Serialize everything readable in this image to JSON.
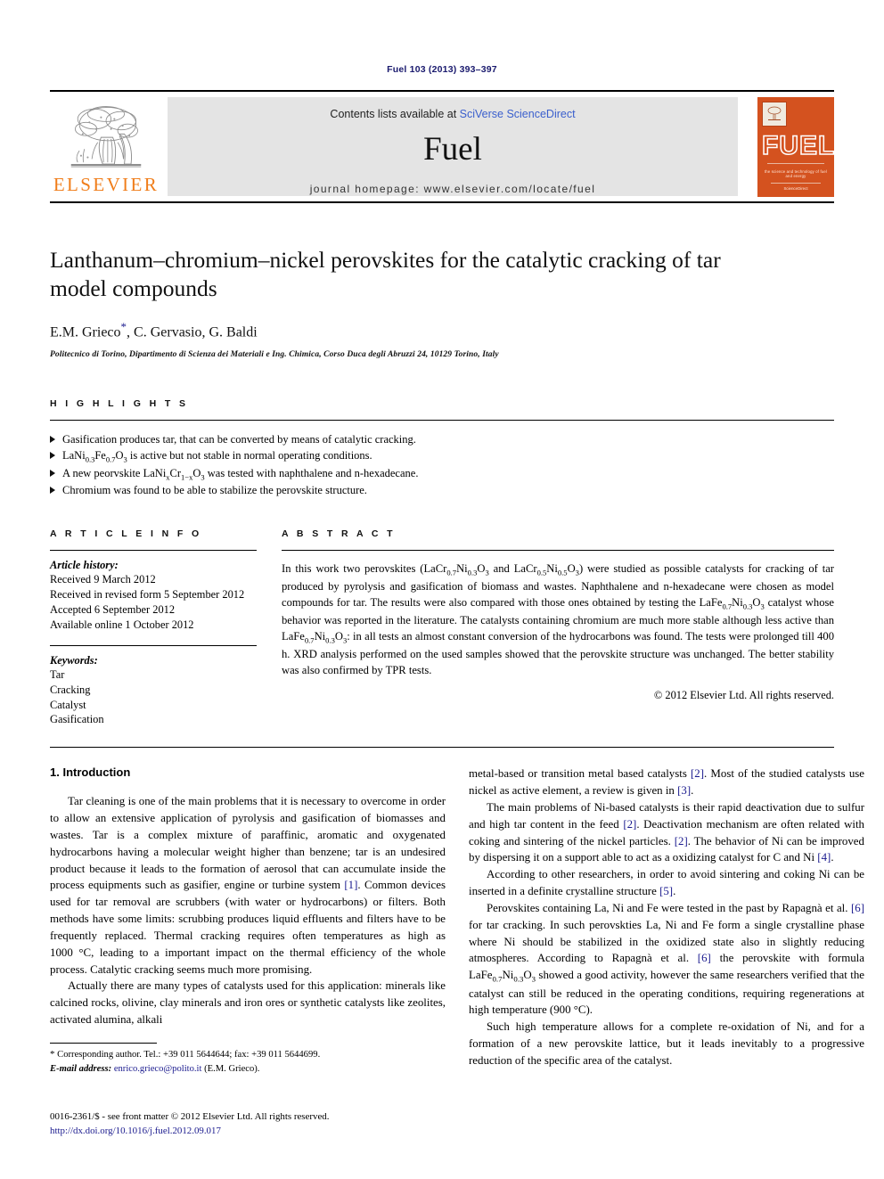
{
  "running_head": "Fuel 103 (2013) 393–397",
  "masthead": {
    "publisher_name": "ELSEVIER",
    "contents_prefix": "Contents lists available at ",
    "contents_link": "SciVerse ScienceDirect",
    "journal_title": "Fuel",
    "homepage": "journal homepage: www.elsevier.com/locate/fuel",
    "cover": {
      "title": "FUEL",
      "tagline": "the science and technology of fuel and energy",
      "footer": "ScienceDirect"
    }
  },
  "article": {
    "title": "Lanthanum–chromium–nickel perovskites for the catalytic cracking of tar model compounds",
    "authors": "E.M. Grieco",
    "authors_rest": ", C. Gervasio, G. Baldi",
    "corresponding_marker": "*",
    "affiliation": "Politecnico di Torino, Dipartimento di Scienza dei Materiali e Ing. Chimica, Corso Duca degli Abruzzi 24, 10129 Torino, Italy"
  },
  "highlights": {
    "heading": "H I G H L I G H T S",
    "items": [
      "Gasification produces tar, that can be converted by means of catalytic cracking.",
      "LaNi0.3Fe0.7O3 is active but not stable in normal operating conditions.",
      "A new peorvskite LaNixCr1−xO3 was tested with naphthalene and n-hexadecane.",
      "Chromium was found to be able to stabilize the perovskite structure."
    ]
  },
  "article_info": {
    "heading": "A R T I C L E    I N F O",
    "history_label": "Article history:",
    "history": [
      "Received 9 March 2012",
      "Received in revised form 5 September 2012",
      "Accepted 6 September 2012",
      "Available online 1 October 2012"
    ],
    "keywords_label": "Keywords:",
    "keywords": [
      "Tar",
      "Cracking",
      "Catalyst",
      "Gasification"
    ]
  },
  "abstract": {
    "heading": "A B S T R A C T",
    "text": "In this work two perovskites (LaCr0.7Ni0.3O3 and LaCr0.5Ni0.5O3) were studied as possible catalysts for cracking of tar produced by pyrolysis and gasification of biomass and wastes. Naphthalene and n-hexadecane were chosen as model compounds for tar. The results were also compared with those ones obtained by testing the LaFe0.7Ni0.3O3 catalyst whose behavior was reported in the literature. The catalysts containing chromium are much more stable although less active than LaFe0.7Ni0.3O3: in all tests an almost constant conversion of the hydrocarbons was found. The tests were prolonged till 400 h. XRD analysis performed on the used samples showed that the perovskite structure was unchanged. The better stability was also confirmed by TPR tests.",
    "copyright": "© 2012 Elsevier Ltd. All rights reserved."
  },
  "body": {
    "section_title": "1. Introduction",
    "left_paragraphs": [
      "Tar cleaning is one of the main problems that it is necessary to overcome in order to allow an extensive application of pyrolysis and gasification of biomasses and wastes. Tar is a complex mixture of paraffinic, aromatic and oxygenated hydrocarbons having a molecular weight higher than benzene; tar is an undesired product because it leads to the formation of aerosol that can accumulate inside the process equipments such as gasifier, engine or turbine system [1]. Common devices used for tar removal are scrubbers (with water or hydrocarbons) or filters. Both methods have some limits: scrubbing produces liquid effluents and filters have to be frequently replaced. Thermal cracking requires often temperatures as high as 1000 °C, leading to a important impact on the thermal efficiency of the whole process. Catalytic cracking seems much more promising.",
      "Actually there are many types of catalysts used for this application: minerals like calcined rocks, olivine, clay minerals and iron ores or synthetic catalysts like zeolites, activated alumina, alkali"
    ],
    "right_paragraphs": [
      "metal-based or transition metal based catalysts [2]. Most of the studied catalysts use nickel as active element, a review is given in [3].",
      "The main problems of Ni-based catalysts is their rapid deactivation due to sulfur and high tar content in the feed [2]. Deactivation mechanism are often related with coking and sintering of the nickel particles. [2]. The behavior of Ni can be improved by dispersing it on a support able to act as a oxidizing catalyst for C and Ni [4].",
      "According to other researchers, in order to avoid sintering and coking Ni can be inserted in a definite crystalline structure [5].",
      "Perovskites containing La, Ni and Fe were tested in the past by Rapagnà et al. [6] for tar cracking. In such perovskties La, Ni and Fe form a single crystalline phase where Ni should be stabilized in the oxidized state also in slightly reducing atmospheres. According to Rapagnà et al. [6] the perovskite with formula LaFe0.7Ni0.3O3 showed a good activity, however the same researchers verified that the catalyst can still be reduced in the operating conditions, requiring regenerations at high temperature (900 °C).",
      "Such high temperature allows for a complete re-oxidation of Ni, and for a formation of a new perovskite lattice, but it leads inevitably to a progressive reduction of the specific area of the catalyst."
    ]
  },
  "footnotes": {
    "corresponding": "Corresponding author. Tel.: +39 011 5644644; fax: +39 011 5644699.",
    "email_label": "E-mail address:",
    "email": "enrico.grieco@polito.it",
    "email_owner": "(E.M. Grieco)."
  },
  "imprint": {
    "line1": "0016-2361/$ - see front matter © 2012 Elsevier Ltd. All rights reserved.",
    "doi": "http://dx.doi.org/10.1016/j.fuel.2012.09.017"
  }
}
